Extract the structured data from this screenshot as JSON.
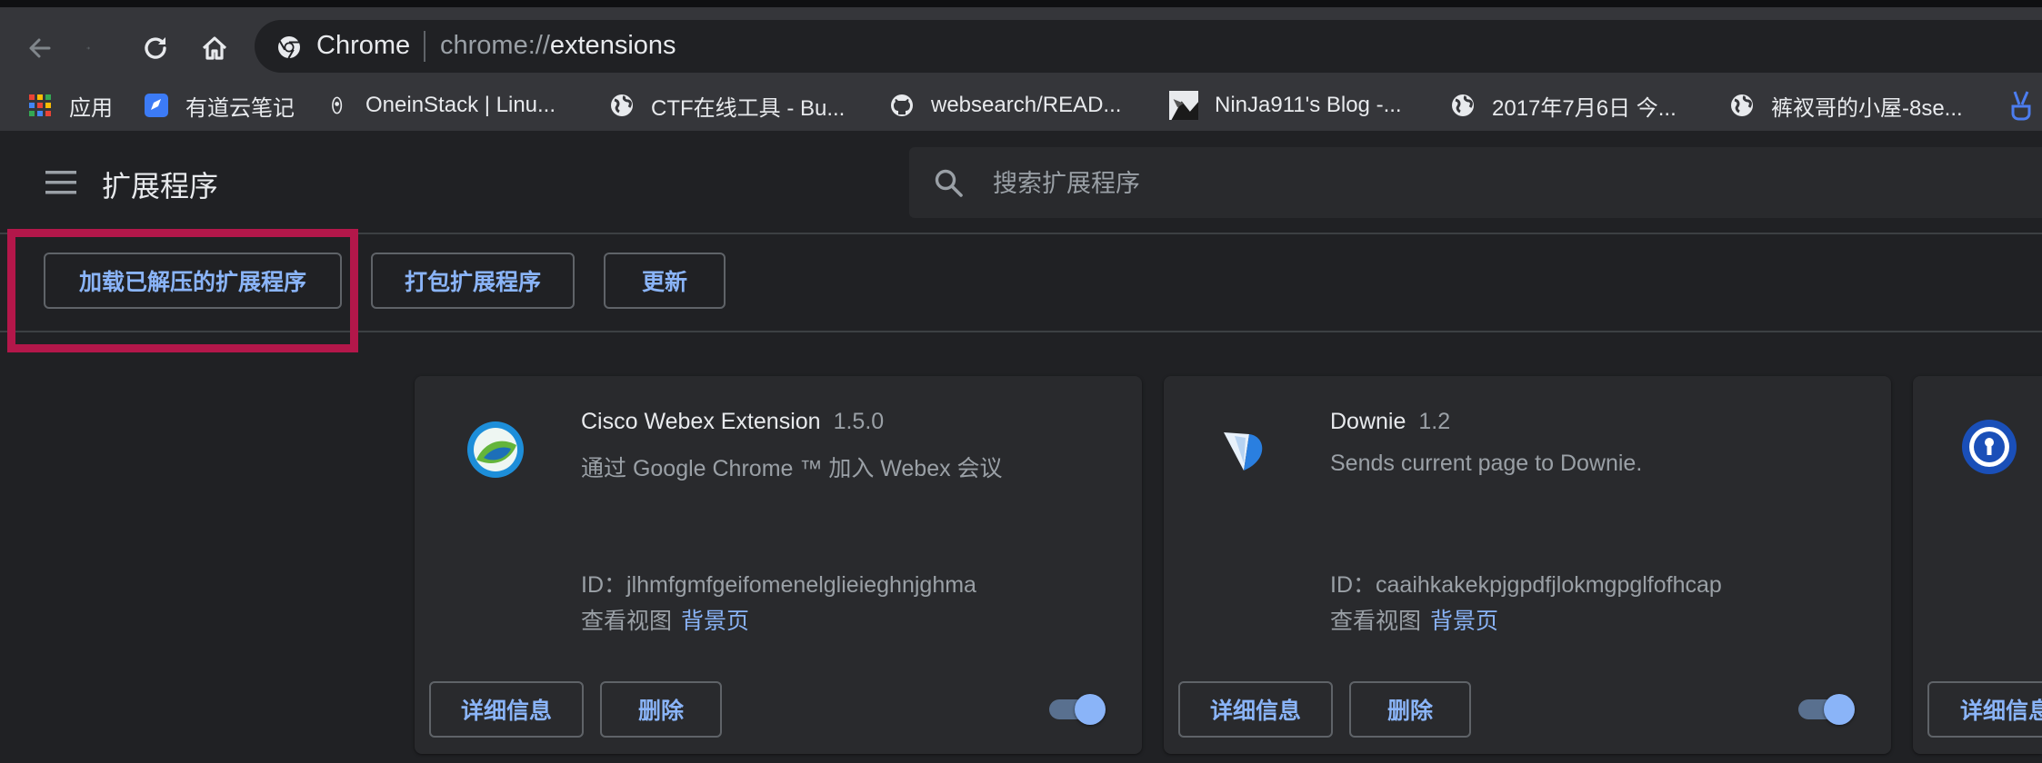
{
  "browser": {
    "omnibox_title": "Chrome",
    "omnibox_url_scheme": "chrome://",
    "omnibox_url_path": "extensions"
  },
  "bookmarks": [
    {
      "label": "应用",
      "icon": "apps-grid-icon"
    },
    {
      "label": "有道云笔记",
      "icon": "youdao-note-icon"
    },
    {
      "label": "OneinStack | Linu...",
      "icon": "oneinstack-icon"
    },
    {
      "label": "CTF在线工具 - Bu...",
      "icon": "globe-icon"
    },
    {
      "label": "websearch/READ...",
      "icon": "github-icon"
    },
    {
      "label": "NinJa911's Blog -...",
      "icon": "blog-avatar-icon"
    },
    {
      "label": "2017年7月6日 今...",
      "icon": "globe-icon"
    },
    {
      "label": "裤衩哥的小屋-8se...",
      "icon": "globe-icon"
    }
  ],
  "header": {
    "title": "扩展程序",
    "search_placeholder": "搜索扩展程序"
  },
  "devbar": {
    "load_unpacked": "加载已解压的扩展程序",
    "pack_extension": "打包扩展程序",
    "update": "更新"
  },
  "cards": [
    {
      "name": "Cisco Webex Extension",
      "version": "1.5.0",
      "description": "通过 Google Chrome ™ 加入 Webex 会议",
      "id_label": "ID：",
      "id": "jlhmfgmfgeifomenelglieieghnjghma",
      "views_label": "查看视图",
      "views_link": "背景页",
      "details_label": "详细信息",
      "remove_label": "删除",
      "enabled": true,
      "icon": "webex-icon"
    },
    {
      "name": "Downie",
      "version": "1.2",
      "description": "Sends current page to Downie.",
      "id_label": "ID：",
      "id": "caaihkakekpjgpdfjlokmgpglfofhcap",
      "views_label": "查看视图",
      "views_link": "背景页",
      "details_label": "详细信息",
      "remove_label": "删除",
      "enabled": true,
      "icon": "downie-icon"
    },
    {
      "details_label": "详细信息",
      "icon": "lock-shield-icon"
    }
  ],
  "colors": {
    "accent": "#8ab4f8",
    "highlight": "#b3174a",
    "background": "#202124",
    "card": "#292a2d"
  }
}
